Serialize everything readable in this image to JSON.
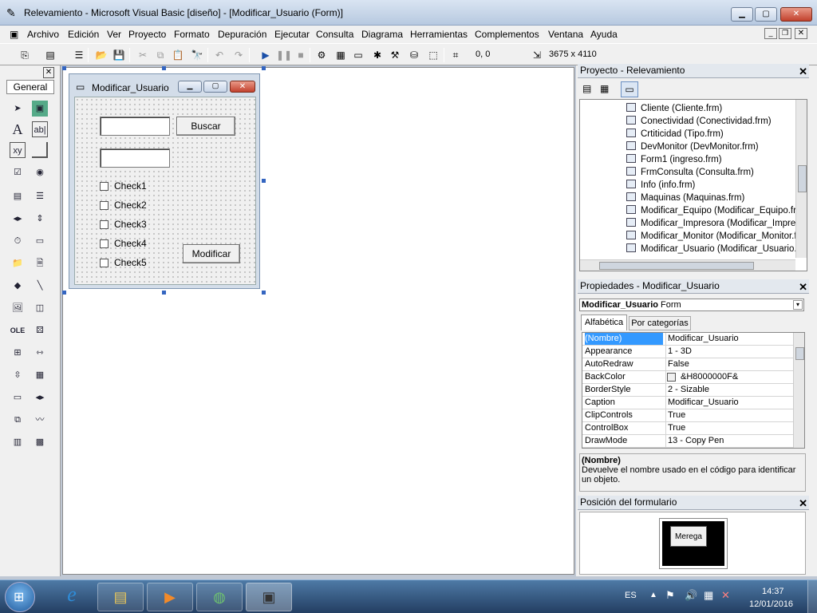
{
  "window": {
    "title": "Relevamiento - Microsoft Visual Basic [diseño] - [Modificar_Usuario (Form)]",
    "min_label": "▁",
    "max_label": "▢",
    "close_label": "✕"
  },
  "menu": {
    "items": [
      "Archivo",
      "Edición",
      "Ver",
      "Proyecto",
      "Formato",
      "Depuración",
      "Ejecutar",
      "Consulta",
      "Diagrama",
      "Herramientas",
      "Complementos",
      "Ventana",
      "Ayuda"
    ]
  },
  "toolbar": {
    "coords": "0, 0",
    "size": "3675 x 4110"
  },
  "toolbox": {
    "tab_label": "General",
    "close_label": "✕"
  },
  "form": {
    "caption": "Modificar_Usuario",
    "buscar_label": "Buscar",
    "modificar_label": "Modificar",
    "checks": [
      "Check1",
      "Check2",
      "Check3",
      "Check4",
      "Check5"
    ]
  },
  "project": {
    "title": "Proyecto - Relevamiento",
    "items": [
      "Cliente (Cliente.frm)",
      "Conectividad (Conectividad.frm)",
      "Crtiticidad (Tipo.frm)",
      "DevMonitor (DevMonitor.frm)",
      "Form1 (ingreso.frm)",
      "FrmConsulta (Consulta.frm)",
      "Info (info.frm)",
      "Maquinas (Maquinas.frm)",
      "Modificar_Equipo (Modificar_Equipo.frm",
      "Modificar_Impresora (Modificar_Impreso",
      "Modificar_Monitor (Modificar_Monitor.fr",
      "Modificar_Usuario (Modificar_Usuario.fr"
    ]
  },
  "properties": {
    "title": "Propiedades - Modificar_Usuario",
    "object_name": "Modificar_Usuario",
    "object_type": "Form",
    "tab_alpha": "Alfabética",
    "tab_cat": "Por categorías",
    "rows": [
      {
        "name": "(Nombre)",
        "value": "Modificar_Usuario"
      },
      {
        "name": "Appearance",
        "value": "1 - 3D"
      },
      {
        "name": "AutoRedraw",
        "value": "False"
      },
      {
        "name": "BackColor",
        "value": "&H8000000F&"
      },
      {
        "name": "BorderStyle",
        "value": "2 - Sizable"
      },
      {
        "name": "Caption",
        "value": "Modificar_Usuario"
      },
      {
        "name": "ClipControls",
        "value": "True"
      },
      {
        "name": "ControlBox",
        "value": "True"
      },
      {
        "name": "DrawMode",
        "value": "13 - Copy Pen"
      }
    ],
    "desc_title": "(Nombre)",
    "desc_text": "Devuelve el nombre usado en el código para identificar un objeto."
  },
  "form_position": {
    "title": "Posición del formulario",
    "preview_label": "Merega"
  },
  "taskbar": {
    "lang": "ES",
    "time": "14:37",
    "date": "12/01/2016"
  },
  "colors": {
    "accent": "#3399ff",
    "taskbar": "#233e62"
  }
}
